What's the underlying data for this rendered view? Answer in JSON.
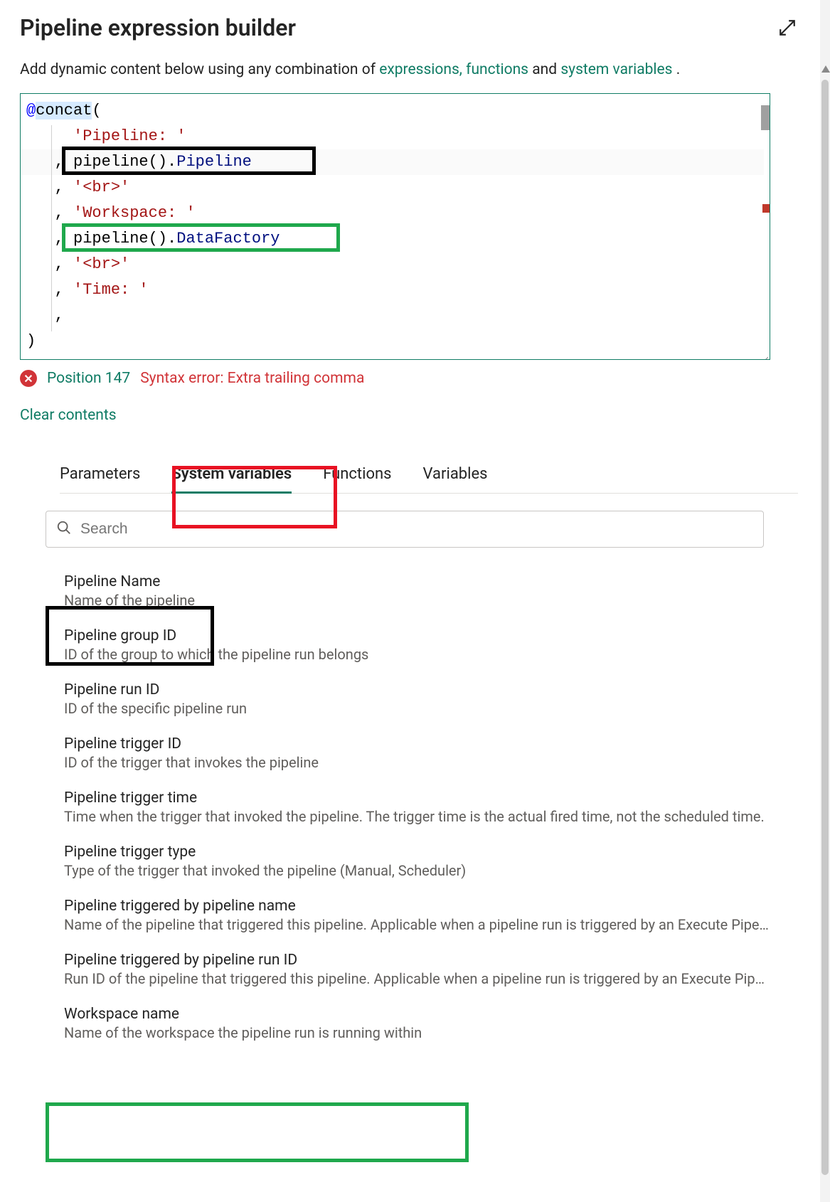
{
  "header": {
    "title": "Pipeline expression builder"
  },
  "intro": {
    "prefix": "Add dynamic content below using any combination of ",
    "link1": "expressions,",
    "link2": "functions",
    "mid": " and ",
    "link3": "system variables",
    "suffix": "."
  },
  "editor_lines": {
    "l0a": "@",
    "l0b": "concat",
    "l0c": "(",
    "l1a": "     ",
    "l1b": "'Pipeline: '",
    "l2a": "   , ",
    "l2b": "pipeline",
    "l2c": "().",
    "l2d": "Pipeline",
    "l3a": "   , ",
    "l3b": "'<br>'",
    "l4a": "   , ",
    "l4b": "'Workspace: '",
    "l5a": "   , ",
    "l5b": "pipeline",
    "l5c": "().",
    "l5d": "DataFactory",
    "l6a": "   , ",
    "l6b": "'<br>'",
    "l7a": "   , ",
    "l7b": "'Time: '",
    "l8a": "   ,",
    "l9": ")"
  },
  "error": {
    "position": "Position 147",
    "message": "Syntax error: Extra trailing comma"
  },
  "clear_label": "Clear contents",
  "tabs": {
    "t0": "Parameters",
    "t1": "System variables",
    "t2": "Functions",
    "t3": "Variables"
  },
  "search": {
    "placeholder": "Search"
  },
  "variables": [
    {
      "title": "Pipeline Name",
      "desc": "Name of the pipeline"
    },
    {
      "title": "Pipeline group ID",
      "desc": "ID of the group to which the pipeline run belongs"
    },
    {
      "title": "Pipeline run ID",
      "desc": "ID of the specific pipeline run"
    },
    {
      "title": "Pipeline trigger ID",
      "desc": "ID of the trigger that invokes the pipeline"
    },
    {
      "title": "Pipeline trigger time",
      "desc": "Time when the trigger that invoked the pipeline. The trigger time is the actual fired time, not the scheduled time."
    },
    {
      "title": "Pipeline trigger type",
      "desc": "Type of the trigger that invoked the pipeline (Manual, Scheduler)"
    },
    {
      "title": "Pipeline triggered by pipeline name",
      "desc": "Name of the pipeline that triggered this pipeline. Applicable when a pipeline run is triggered by an Execute Pipeline activity."
    },
    {
      "title": "Pipeline triggered by pipeline run ID",
      "desc": "Run ID of the pipeline that triggered this pipeline. Applicable when a pipeline run is triggered by an Execute Pipeline activity."
    },
    {
      "title": "Workspace name",
      "desc": "Name of the workspace the pipeline run is running within"
    }
  ]
}
